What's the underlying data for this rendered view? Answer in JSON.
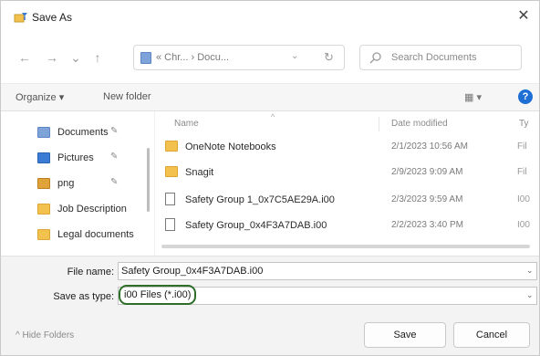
{
  "window": {
    "title": "Save As",
    "close_glyph": "✕"
  },
  "nav": {
    "back_glyph": "←",
    "forward_glyph": "→",
    "recent_glyph": "⌄",
    "up_glyph": "↑",
    "address_crumbs": "« Chr... › Docu...",
    "address_drop_glyph": "⌄",
    "refresh_glyph": "↻",
    "search_placeholder": "Search Documents"
  },
  "toolbar": {
    "organize_label": "Organize ▾",
    "new_folder_label": "New folder",
    "view_glyph": "▦ ▾",
    "help_glyph": "?"
  },
  "sidebar": {
    "items": [
      {
        "label": "Documents",
        "icon": "documents-icon",
        "color": "#7ea3d9",
        "pinned": true
      },
      {
        "label": "Pictures",
        "icon": "pictures-icon",
        "color": "#3a7bd5",
        "pinned": true
      },
      {
        "label": "png",
        "icon": "png-folder-icon",
        "color": "#e0a33a",
        "pinned": true
      },
      {
        "label": "Job Description",
        "icon": "folder-icon",
        "color": "#f2c14e",
        "pinned": false
      },
      {
        "label": "Legal documents",
        "icon": "folder-icon",
        "color": "#f2c14e",
        "pinned": false
      }
    ],
    "pin_glyph": "📌"
  },
  "file_list": {
    "columns": {
      "name": "Name",
      "date": "Date modified",
      "type": "Ty"
    },
    "sort_glyph": "^",
    "rows": [
      {
        "name": "OneNote Notebooks",
        "date": "2/1/2023 10:56 AM",
        "type": "Fil",
        "icon": "folder-icon"
      },
      {
        "name": "Snagit",
        "date": "2/9/2023 9:09 AM",
        "type": "Fil",
        "icon": "folder-icon"
      },
      {
        "name": "Safety Group 1_0x7C5AE29A.i00",
        "date": "2/3/2023 9:59 AM",
        "type": "I00",
        "icon": "file-icon"
      },
      {
        "name": "Safety Group_0x4F3A7DAB.i00",
        "date": "2/2/2023 3:40 PM",
        "type": "I00",
        "icon": "file-icon"
      }
    ]
  },
  "fields": {
    "file_name_label": "File name:",
    "file_name_value": "Safety Group_0x4F3A7DAB.i00",
    "save_type_label": "Save as type:",
    "save_type_value": "i00 Files (*.i00)",
    "drop_glyph": "⌄",
    "highlight_color": "#2e6e28"
  },
  "footer": {
    "hide_folders_label": "^ Hide Folders",
    "save_label": "Save",
    "cancel_label": "Cancel"
  }
}
